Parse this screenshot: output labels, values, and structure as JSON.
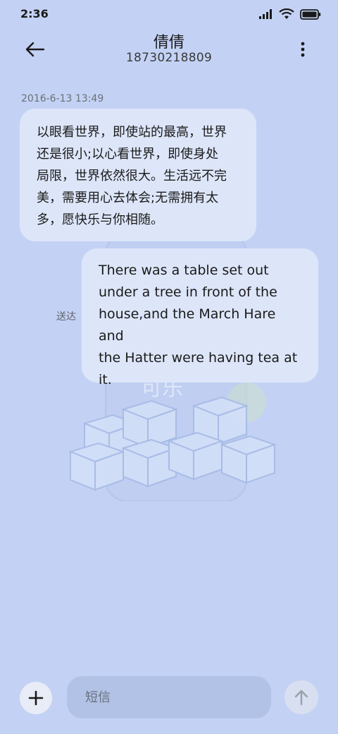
{
  "status_bar": {
    "time": "2:36"
  },
  "header": {
    "contact_name": "倩倩",
    "contact_number": "18730218809",
    "icons": {
      "back": "back-arrow-icon",
      "more": "more-vertical-icon"
    }
  },
  "conversation": {
    "timestamp": "2016-6-13 13:49",
    "messages": [
      {
        "direction": "incoming",
        "lines": [
          "以眼看世界，即使站的最高，世界",
          "还是很小;以心看世界，即使身处",
          "局限，世界依然很大。生活远不完",
          "美，需要用心去体会;无需拥有太",
          "多，愿快乐与你相随。"
        ]
      },
      {
        "direction": "outgoing",
        "lines": [
          "There was a table set out",
          "under a tree in front of the",
          "house,and the March Hare and",
          "the Hatter were having tea at",
          "it."
        ],
        "status": "送达"
      }
    ]
  },
  "composer": {
    "placeholder": "短信",
    "icons": {
      "add": "plus-icon",
      "send": "send-arrow-icon"
    }
  },
  "colors": {
    "background": "#c3d2f4",
    "bubble": "#dde6f9",
    "input": "#b2c2e6"
  }
}
